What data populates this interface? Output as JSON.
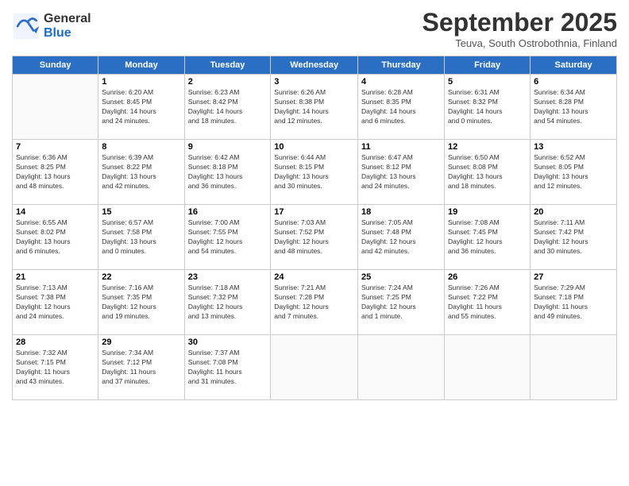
{
  "header": {
    "logo_general": "General",
    "logo_blue": "Blue",
    "month_title": "September 2025",
    "subtitle": "Teuva, South Ostrobothnia, Finland"
  },
  "days_of_week": [
    "Sunday",
    "Monday",
    "Tuesday",
    "Wednesday",
    "Thursday",
    "Friday",
    "Saturday"
  ],
  "weeks": [
    [
      {
        "day": "",
        "info": ""
      },
      {
        "day": "1",
        "info": "Sunrise: 6:20 AM\nSunset: 8:45 PM\nDaylight: 14 hours\nand 24 minutes."
      },
      {
        "day": "2",
        "info": "Sunrise: 6:23 AM\nSunset: 8:42 PM\nDaylight: 14 hours\nand 18 minutes."
      },
      {
        "day": "3",
        "info": "Sunrise: 6:26 AM\nSunset: 8:38 PM\nDaylight: 14 hours\nand 12 minutes."
      },
      {
        "day": "4",
        "info": "Sunrise: 6:28 AM\nSunset: 8:35 PM\nDaylight: 14 hours\nand 6 minutes."
      },
      {
        "day": "5",
        "info": "Sunrise: 6:31 AM\nSunset: 8:32 PM\nDaylight: 14 hours\nand 0 minutes."
      },
      {
        "day": "6",
        "info": "Sunrise: 6:34 AM\nSunset: 8:28 PM\nDaylight: 13 hours\nand 54 minutes."
      }
    ],
    [
      {
        "day": "7",
        "info": "Sunrise: 6:36 AM\nSunset: 8:25 PM\nDaylight: 13 hours\nand 48 minutes."
      },
      {
        "day": "8",
        "info": "Sunrise: 6:39 AM\nSunset: 8:22 PM\nDaylight: 13 hours\nand 42 minutes."
      },
      {
        "day": "9",
        "info": "Sunrise: 6:42 AM\nSunset: 8:18 PM\nDaylight: 13 hours\nand 36 minutes."
      },
      {
        "day": "10",
        "info": "Sunrise: 6:44 AM\nSunset: 8:15 PM\nDaylight: 13 hours\nand 30 minutes."
      },
      {
        "day": "11",
        "info": "Sunrise: 6:47 AM\nSunset: 8:12 PM\nDaylight: 13 hours\nand 24 minutes."
      },
      {
        "day": "12",
        "info": "Sunrise: 6:50 AM\nSunset: 8:08 PM\nDaylight: 13 hours\nand 18 minutes."
      },
      {
        "day": "13",
        "info": "Sunrise: 6:52 AM\nSunset: 8:05 PM\nDaylight: 13 hours\nand 12 minutes."
      }
    ],
    [
      {
        "day": "14",
        "info": "Sunrise: 6:55 AM\nSunset: 8:02 PM\nDaylight: 13 hours\nand 6 minutes."
      },
      {
        "day": "15",
        "info": "Sunrise: 6:57 AM\nSunset: 7:58 PM\nDaylight: 13 hours\nand 0 minutes."
      },
      {
        "day": "16",
        "info": "Sunrise: 7:00 AM\nSunset: 7:55 PM\nDaylight: 12 hours\nand 54 minutes."
      },
      {
        "day": "17",
        "info": "Sunrise: 7:03 AM\nSunset: 7:52 PM\nDaylight: 12 hours\nand 48 minutes."
      },
      {
        "day": "18",
        "info": "Sunrise: 7:05 AM\nSunset: 7:48 PM\nDaylight: 12 hours\nand 42 minutes."
      },
      {
        "day": "19",
        "info": "Sunrise: 7:08 AM\nSunset: 7:45 PM\nDaylight: 12 hours\nand 36 minutes."
      },
      {
        "day": "20",
        "info": "Sunrise: 7:11 AM\nSunset: 7:42 PM\nDaylight: 12 hours\nand 30 minutes."
      }
    ],
    [
      {
        "day": "21",
        "info": "Sunrise: 7:13 AM\nSunset: 7:38 PM\nDaylight: 12 hours\nand 24 minutes."
      },
      {
        "day": "22",
        "info": "Sunrise: 7:16 AM\nSunset: 7:35 PM\nDaylight: 12 hours\nand 19 minutes."
      },
      {
        "day": "23",
        "info": "Sunrise: 7:18 AM\nSunset: 7:32 PM\nDaylight: 12 hours\nand 13 minutes."
      },
      {
        "day": "24",
        "info": "Sunrise: 7:21 AM\nSunset: 7:28 PM\nDaylight: 12 hours\nand 7 minutes."
      },
      {
        "day": "25",
        "info": "Sunrise: 7:24 AM\nSunset: 7:25 PM\nDaylight: 12 hours\nand 1 minute."
      },
      {
        "day": "26",
        "info": "Sunrise: 7:26 AM\nSunset: 7:22 PM\nDaylight: 11 hours\nand 55 minutes."
      },
      {
        "day": "27",
        "info": "Sunrise: 7:29 AM\nSunset: 7:18 PM\nDaylight: 11 hours\nand 49 minutes."
      }
    ],
    [
      {
        "day": "28",
        "info": "Sunrise: 7:32 AM\nSunset: 7:15 PM\nDaylight: 11 hours\nand 43 minutes."
      },
      {
        "day": "29",
        "info": "Sunrise: 7:34 AM\nSunset: 7:12 PM\nDaylight: 11 hours\nand 37 minutes."
      },
      {
        "day": "30",
        "info": "Sunrise: 7:37 AM\nSunset: 7:08 PM\nDaylight: 11 hours\nand 31 minutes."
      },
      {
        "day": "",
        "info": ""
      },
      {
        "day": "",
        "info": ""
      },
      {
        "day": "",
        "info": ""
      },
      {
        "day": "",
        "info": ""
      }
    ]
  ]
}
